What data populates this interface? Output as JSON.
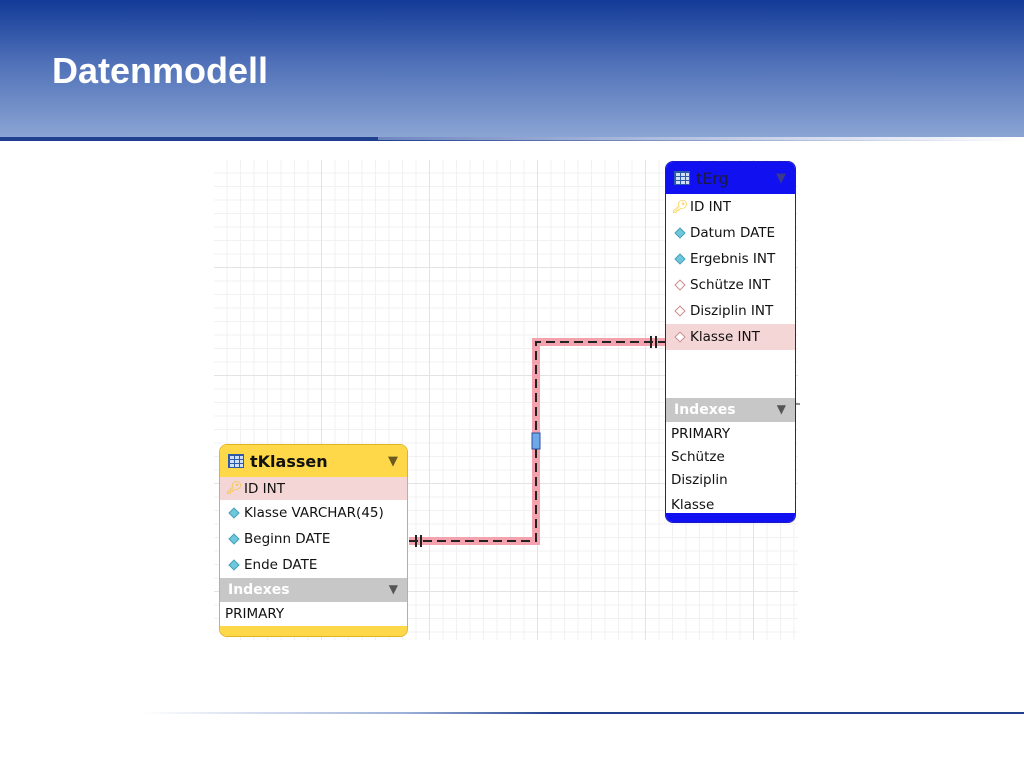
{
  "slide": {
    "title": "Datenmodell"
  },
  "tables": {
    "tErg": {
      "name": "tErg",
      "color": "#1010f0",
      "columns": [
        {
          "label": "ID INT",
          "icon": "key-icon",
          "highlight": false
        },
        {
          "label": "Datum DATE",
          "icon": "column-diamond-filled-icon",
          "highlight": false
        },
        {
          "label": "Ergebnis INT",
          "icon": "column-diamond-filled-icon",
          "highlight": false
        },
        {
          "label": "Schütze INT",
          "icon": "column-diamond-open-icon",
          "highlight": false
        },
        {
          "label": "Disziplin INT",
          "icon": "column-diamond-open-icon",
          "highlight": false
        },
        {
          "label": "Klasse INT",
          "icon": "column-diamond-open-icon",
          "highlight": true
        }
      ],
      "indexes_label": "Indexes",
      "indexes": [
        "PRIMARY",
        "Schütze",
        "Disziplin",
        "Klasse"
      ]
    },
    "tKlassen": {
      "name": "tKlassen",
      "color": "#ffd84a",
      "columns": [
        {
          "label": "ID INT",
          "icon": "key-icon",
          "highlight": true
        },
        {
          "label": "Klasse VARCHAR(45)",
          "icon": "column-diamond-filled-icon",
          "highlight": false
        },
        {
          "label": "Beginn DATE",
          "icon": "column-diamond-filled-icon",
          "highlight": false
        },
        {
          "label": "Ende DATE",
          "icon": "column-diamond-filled-icon",
          "highlight": false
        }
      ],
      "indexes_label": "Indexes",
      "indexes": [
        "PRIMARY"
      ]
    }
  },
  "relationship": {
    "from": "tKlassen.ID",
    "to": "tErg.Klasse",
    "cardinality": "one-to-many",
    "highlight_color": "#f08a9a"
  }
}
